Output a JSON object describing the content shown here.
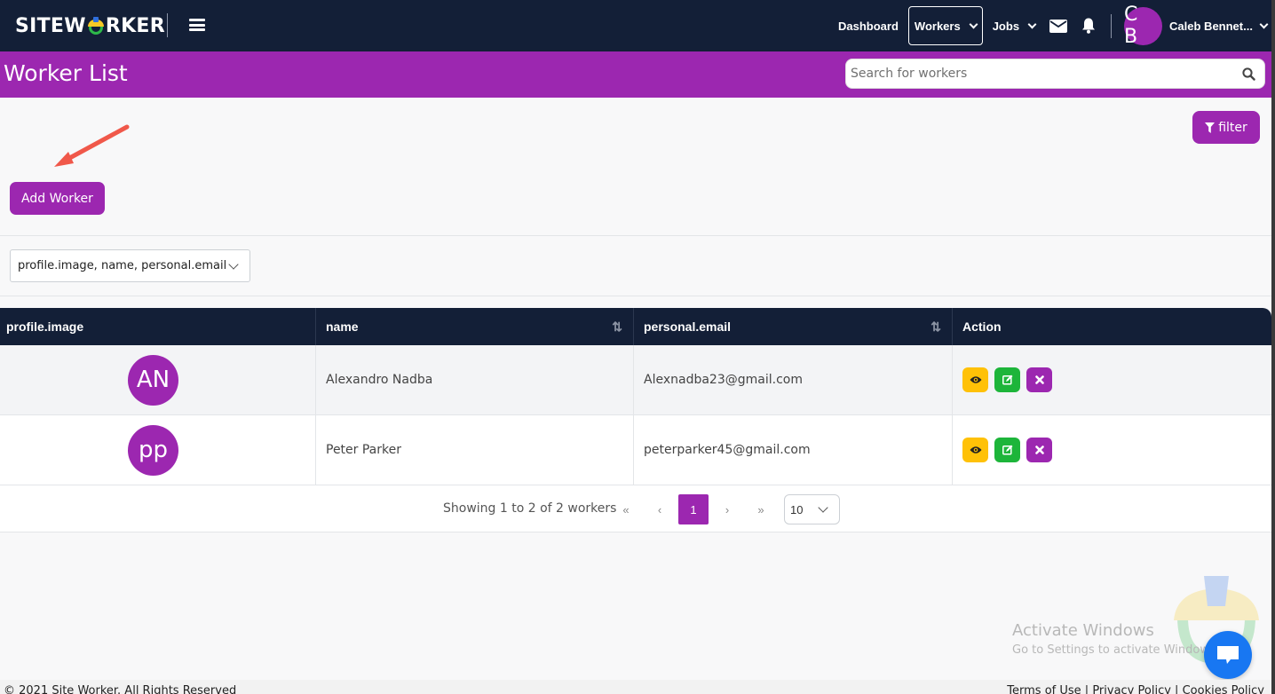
{
  "navbar": {
    "logo_text_left": "SITEW",
    "logo_text_right": "RKER",
    "links": [
      {
        "label": "Dashboard",
        "active": false,
        "dropdown": false
      },
      {
        "label": "Workers",
        "active": true,
        "dropdown": true
      },
      {
        "label": "Jobs",
        "active": false,
        "dropdown": true
      }
    ],
    "icons": [
      "mail-icon",
      "bell-icon"
    ],
    "user": {
      "initials": "C B",
      "name": "Caleb Bennet..."
    }
  },
  "header": {
    "title": "Worker List",
    "search_placeholder": "Search for workers",
    "search_value": ""
  },
  "toolbar": {
    "filter_label": "filter",
    "add_worker_label": "Add Worker",
    "columns_select_value": "profile.image, name, personal.email"
  },
  "table": {
    "columns": [
      {
        "label": "profile.image",
        "sortable": false
      },
      {
        "label": "name",
        "sortable": true
      },
      {
        "label": "personal.email",
        "sortable": true
      },
      {
        "label": "Action",
        "sortable": false
      }
    ],
    "rows": [
      {
        "initials": "AN",
        "name": "Alexandro Nadba",
        "email": "Alexnadba23@gmail.com"
      },
      {
        "initials": "pp",
        "name": "Peter Parker",
        "email": "peterparker45@gmail.com"
      }
    ],
    "sort_glyph": "⇅"
  },
  "pagination": {
    "info": "Showing 1 to 2 of 2 workers",
    "first": "«",
    "prev": "‹",
    "current_page": "1",
    "next": "›",
    "last": "»",
    "per_page": "10"
  },
  "watermark": {
    "line1": "Activate Windows",
    "line2": "Go to Settings to activate Windows."
  },
  "footer": {
    "copyright": "© 2021 Site Worker. All Rights Reserved",
    "links": [
      "Terms of Use",
      "Privacy Policy",
      "Cookies Policy"
    ],
    "separator": " | "
  },
  "colors": {
    "navbar_bg": "#131f37",
    "accent_purple": "#9c27b0",
    "view_yellow": "#ffc107",
    "edit_green": "#1db53a",
    "chat_blue": "#1877f2"
  }
}
